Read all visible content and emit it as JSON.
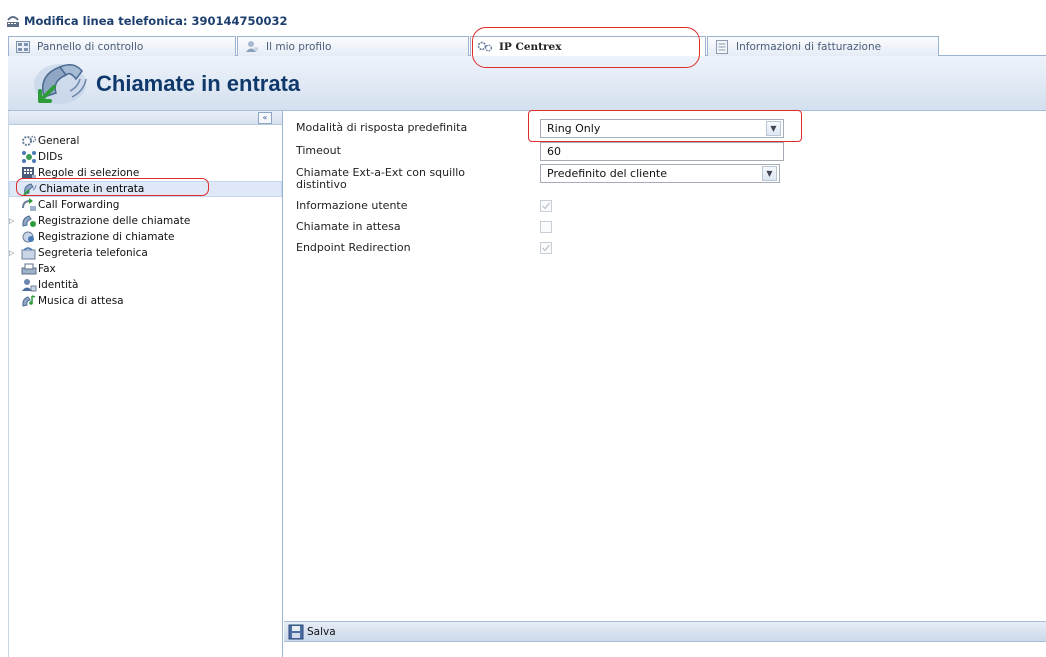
{
  "window": {
    "title": "Modifica linea telefonica: 390144750032"
  },
  "tabs": [
    {
      "label": "Pannello di controllo",
      "icon": "control-panel-icon",
      "active": false
    },
    {
      "label": "Il mio profilo",
      "icon": "user-profile-icon",
      "active": false
    },
    {
      "label": "IP Centrex",
      "icon": "ip-centrex-icon",
      "active": true
    },
    {
      "label": "Informazioni di fatturazione",
      "icon": "billing-document-icon",
      "active": false
    }
  ],
  "header": {
    "title": "Chiamate in entrata",
    "icon": "incoming-call-phone-icon"
  },
  "sidebar": {
    "collapse_label": "«",
    "items": [
      {
        "label": "General",
        "icon": "gear-icon",
        "expandable": false,
        "selected": false
      },
      {
        "label": "DIDs",
        "icon": "network-icon",
        "expandable": false,
        "selected": false
      },
      {
        "label": "Regole di selezione",
        "icon": "dial-rules-icon",
        "expandable": false,
        "selected": false
      },
      {
        "label": "Chiamate in entrata",
        "icon": "incoming-call-icon",
        "expandable": false,
        "selected": true
      },
      {
        "label": "Call Forwarding",
        "icon": "call-forwarding-icon",
        "expandable": false,
        "selected": false
      },
      {
        "label": "Registrazione delle chiamate",
        "icon": "call-recording-icon",
        "expandable": true,
        "selected": false
      },
      {
        "label": "Registrazione di chiamate",
        "icon": "call-log-icon",
        "expandable": false,
        "selected": false
      },
      {
        "label": "Segreteria telefonica",
        "icon": "voicemail-icon",
        "expandable": true,
        "selected": false
      },
      {
        "label": "Fax",
        "icon": "fax-icon",
        "expandable": false,
        "selected": false
      },
      {
        "label": "Identità",
        "icon": "identity-icon",
        "expandable": false,
        "selected": false
      },
      {
        "label": "Musica di attesa",
        "icon": "music-on-hold-icon",
        "expandable": false,
        "selected": false
      }
    ]
  },
  "form": {
    "answer_mode": {
      "label": "Modalità di risposta predefinita",
      "value": "Ring Only"
    },
    "timeout": {
      "label": "Timeout",
      "value": "60"
    },
    "distinctive_ring": {
      "label": "Chiamate Ext-a-Ext con squillo distintivo",
      "value": "Predefinito del cliente"
    },
    "user_info": {
      "label": "Informazione utente",
      "checked": true
    },
    "call_waiting": {
      "label": "Chiamate in attesa",
      "checked": false
    },
    "endpoint_redirection": {
      "label": "Endpoint Redirection",
      "checked": true
    }
  },
  "footer": {
    "save_label": "Salva"
  },
  "colors": {
    "annotation": "#e02b2b",
    "header_title": "#10396b",
    "window_title": "#1d3f6e"
  }
}
